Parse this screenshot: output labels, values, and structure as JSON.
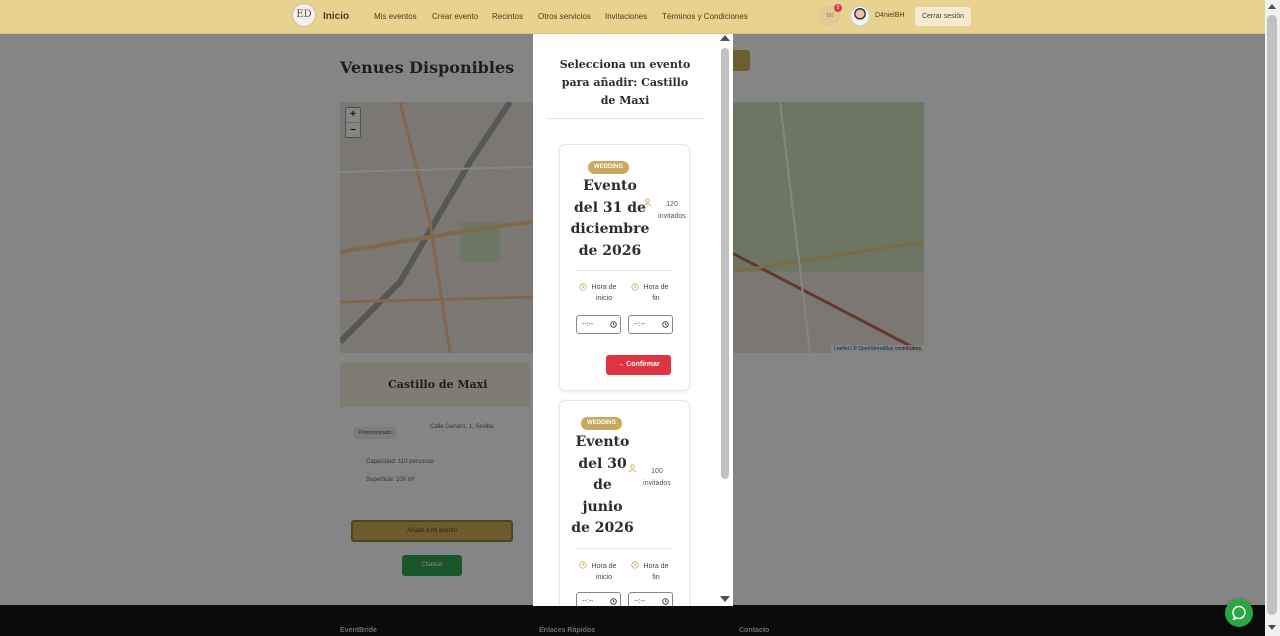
{
  "navbar": {
    "logo_text": "ED",
    "brand": "Inicio",
    "links": [
      "Mis eventos",
      "Crear evento",
      "Recintos",
      "Otros servicios",
      "Invitaciones",
      "Términos y Condiciones"
    ],
    "notifications_label": "txt",
    "notification_count": "2",
    "username": "D4nielBH",
    "logout_label": "Cerrar sesión"
  },
  "page": {
    "title": "Venues Disponibles",
    "map": {
      "zoom_in": "+",
      "zoom_out": "–",
      "attribution_leaflet": "Leaflet",
      "attribution_mid": " | © ",
      "attribution_osm": "OpenStreetMap",
      "attribution_tail": " contributors"
    },
    "venue": {
      "name": "Castillo de Maxi",
      "badge": "Promocionado",
      "address": "Calle Genaro, 1, Sevilla",
      "capacity": "Capacidad: 110 personas",
      "surface": "Superficie: 100 m²",
      "add_button": "Añadir a mi evento",
      "chat_button": "Chatear"
    },
    "footer": {
      "col1": "EventBride",
      "col2": "Enlaces Rápidos",
      "col3": "Contacto"
    }
  },
  "modal": {
    "title": "Selecciona un evento para añadir: Castillo de Maxi",
    "events": [
      {
        "type": "WEDDING",
        "name_lines": [
          "Evento",
          "del 31 de",
          "diciembre",
          "de 2026"
        ],
        "guests_count": "120",
        "guests_label": "invitados",
        "start_label_1": "Hora de",
        "start_label_2": "inicio",
        "end_label_1": "Hora de",
        "end_label_2": "fin",
        "start_value": "--:--",
        "end_value": "--:--",
        "confirm_label": "Confirmar"
      },
      {
        "type": "WEDDING",
        "name_lines": [
          "Evento",
          "del 30",
          "de",
          "junio",
          "de 2026"
        ],
        "guests_count": "100",
        "guests_label": "invitados",
        "start_label_1": "Hora de",
        "start_label_2": "inicio",
        "end_label_1": "Hora de",
        "end_label_2": "fin",
        "start_value": "--:--",
        "end_value": "--:--"
      }
    ]
  },
  "colors": {
    "navbar": "#e8d28f",
    "accent_gold": "#c9a95c",
    "confirm_red": "#df3441",
    "chat_green": "#27a844",
    "footer": "#161616"
  }
}
